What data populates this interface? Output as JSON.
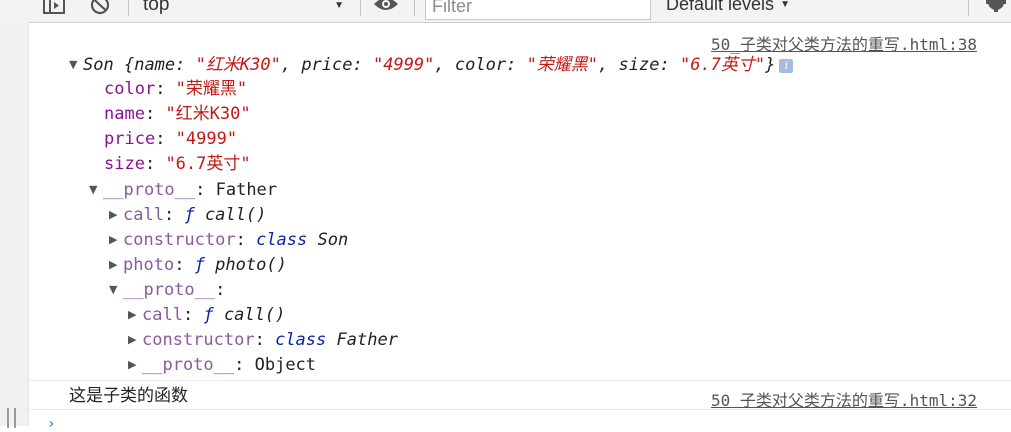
{
  "toolbar": {
    "context": "top",
    "filter_placeholder": "Filter",
    "levels_label": "Default levels"
  },
  "messages": [
    {
      "source": "50_子类对父类方法的重写.html:38",
      "object": {
        "class_name": "Son",
        "preview": [
          {
            "key": "name",
            "value": "\"红米K30\""
          },
          {
            "key": "price",
            "value": "\"4999\""
          },
          {
            "key": "color",
            "value": "\"荣耀黑\""
          },
          {
            "key": "size",
            "value": "\"6.7英寸\""
          }
        ],
        "props": [
          {
            "key": "color",
            "value": "\"荣耀黑\""
          },
          {
            "key": "name",
            "value": "\"红米K30\""
          },
          {
            "key": "price",
            "value": "\"4999\""
          },
          {
            "key": "size",
            "value": "\"6.7英寸\""
          }
        ],
        "proto": {
          "key": "__proto__",
          "value": "Father",
          "items": [
            {
              "key": "call",
              "prefix": "ƒ",
              "value": "call()"
            },
            {
              "key": "constructor",
              "prefix": "class",
              "value": "Son"
            },
            {
              "key": "photo",
              "prefix": "ƒ",
              "value": "photo()"
            }
          ],
          "proto": {
            "key": "__proto__",
            "items": [
              {
                "key": "call",
                "prefix": "ƒ",
                "value": "call()"
              },
              {
                "key": "constructor",
                "prefix": "class",
                "value": "Father"
              },
              {
                "key": "__proto__",
                "prefix": "",
                "value": "Object"
              }
            ]
          }
        }
      }
    },
    {
      "source": "50_子类对父类方法的重写.html:32",
      "text": "这是子类的函数"
    }
  ]
}
